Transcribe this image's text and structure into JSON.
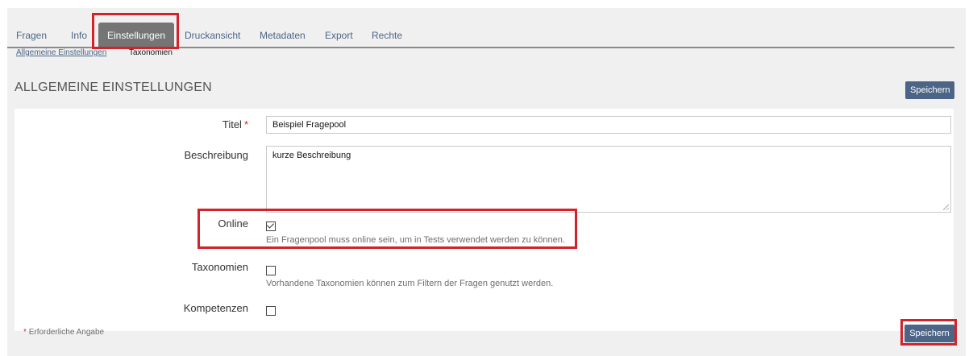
{
  "tabs": [
    {
      "label": "Fragen"
    },
    {
      "label": "Info"
    },
    {
      "label": "Einstellungen",
      "active": true
    },
    {
      "label": "Druckansicht"
    },
    {
      "label": "Metadaten"
    },
    {
      "label": "Export"
    },
    {
      "label": "Rechte"
    }
  ],
  "subtabs": [
    {
      "label": "Allgemeine Einstellungen",
      "active": true
    },
    {
      "label": "Taxonomien"
    }
  ],
  "section": {
    "title": "ALLGEMEINE EINSTELLUNGEN",
    "save_label": "Speichern"
  },
  "form": {
    "title": {
      "label": "Titel",
      "required_mark": "*",
      "value": "Beispiel Fragepool"
    },
    "description": {
      "label": "Beschreibung",
      "value": "kurze Beschreibung"
    },
    "online": {
      "label": "Online",
      "checked": true,
      "help": "Ein Fragenpool muss online sein, um in Tests verwendet werden zu können."
    },
    "taxonomies": {
      "label": "Taxonomien",
      "checked": false,
      "help": "Vorhandene Taxonomien können zum Filtern der Fragen genutzt werden."
    },
    "competences": {
      "label": "Kompetenzen",
      "checked": false
    }
  },
  "footer": {
    "required_mark": "*",
    "required_note": "Erforderliche Angabe",
    "save_label": "Speichern"
  },
  "colors": {
    "highlight": "#d2232a",
    "button": "#4c6586",
    "active_tab": "#757575",
    "link": "#4c6586"
  }
}
